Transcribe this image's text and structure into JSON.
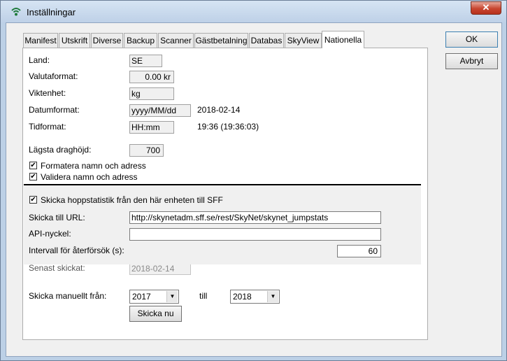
{
  "window": {
    "title": "Inställningar",
    "close_label": "✕"
  },
  "tabs": [
    {
      "label": "Manifest"
    },
    {
      "label": "Utskrift"
    },
    {
      "label": "Diverse"
    },
    {
      "label": "Backup"
    },
    {
      "label": "Scanner"
    },
    {
      "label": "Gästbetalning"
    },
    {
      "label": "Databas"
    },
    {
      "label": "SkyView"
    },
    {
      "label": "Nationella"
    }
  ],
  "active_tab": "Nationella",
  "form": {
    "land_label": "Land:",
    "land_value": "SE",
    "valuta_label": "Valutaformat:",
    "valuta_value": "0.00 kr",
    "vikt_label": "Viktenhet:",
    "vikt_value": "kg",
    "datum_label": "Datumformat:",
    "datum_value": "yyyy/MM/dd",
    "datum_example": "2018-02-14",
    "tid_label": "Tidformat:",
    "tid_value": "HH:mm",
    "tid_example": "19:36  (19:36:03)",
    "dragh_label": "Lägsta draghöjd:",
    "dragh_value": "700",
    "formatera_label": "Formatera namn och adress",
    "formatera_checked": true,
    "validera_label": "Validera namn och adress",
    "validera_checked": true
  },
  "sff": {
    "skicka_label": "Skicka hoppstatistik från den här enheten till SFF",
    "skicka_checked": true,
    "url_label": "Skicka till URL:",
    "url_value": "http://skynetadm.sff.se/rest/SkyNet/skynet_jumpstats",
    "api_label": "API-nyckel:",
    "api_value": "",
    "interval_label": "Intervall för återförsök (s):",
    "interval_value": "60",
    "senast_label": "Senast skickat:",
    "senast_value": "2018-02-14",
    "manual_label": "Skicka manuellt från:",
    "from_year": "2017",
    "till_label": "till",
    "to_year": "2018",
    "send_now_label": "Skicka nu"
  },
  "buttons": {
    "ok": "OK",
    "cancel": "Avbryt"
  },
  "colors": {
    "close_button": "#c8452f",
    "window_frame": "#bcd0e6",
    "dialog_bg": "#f0f0f0"
  }
}
